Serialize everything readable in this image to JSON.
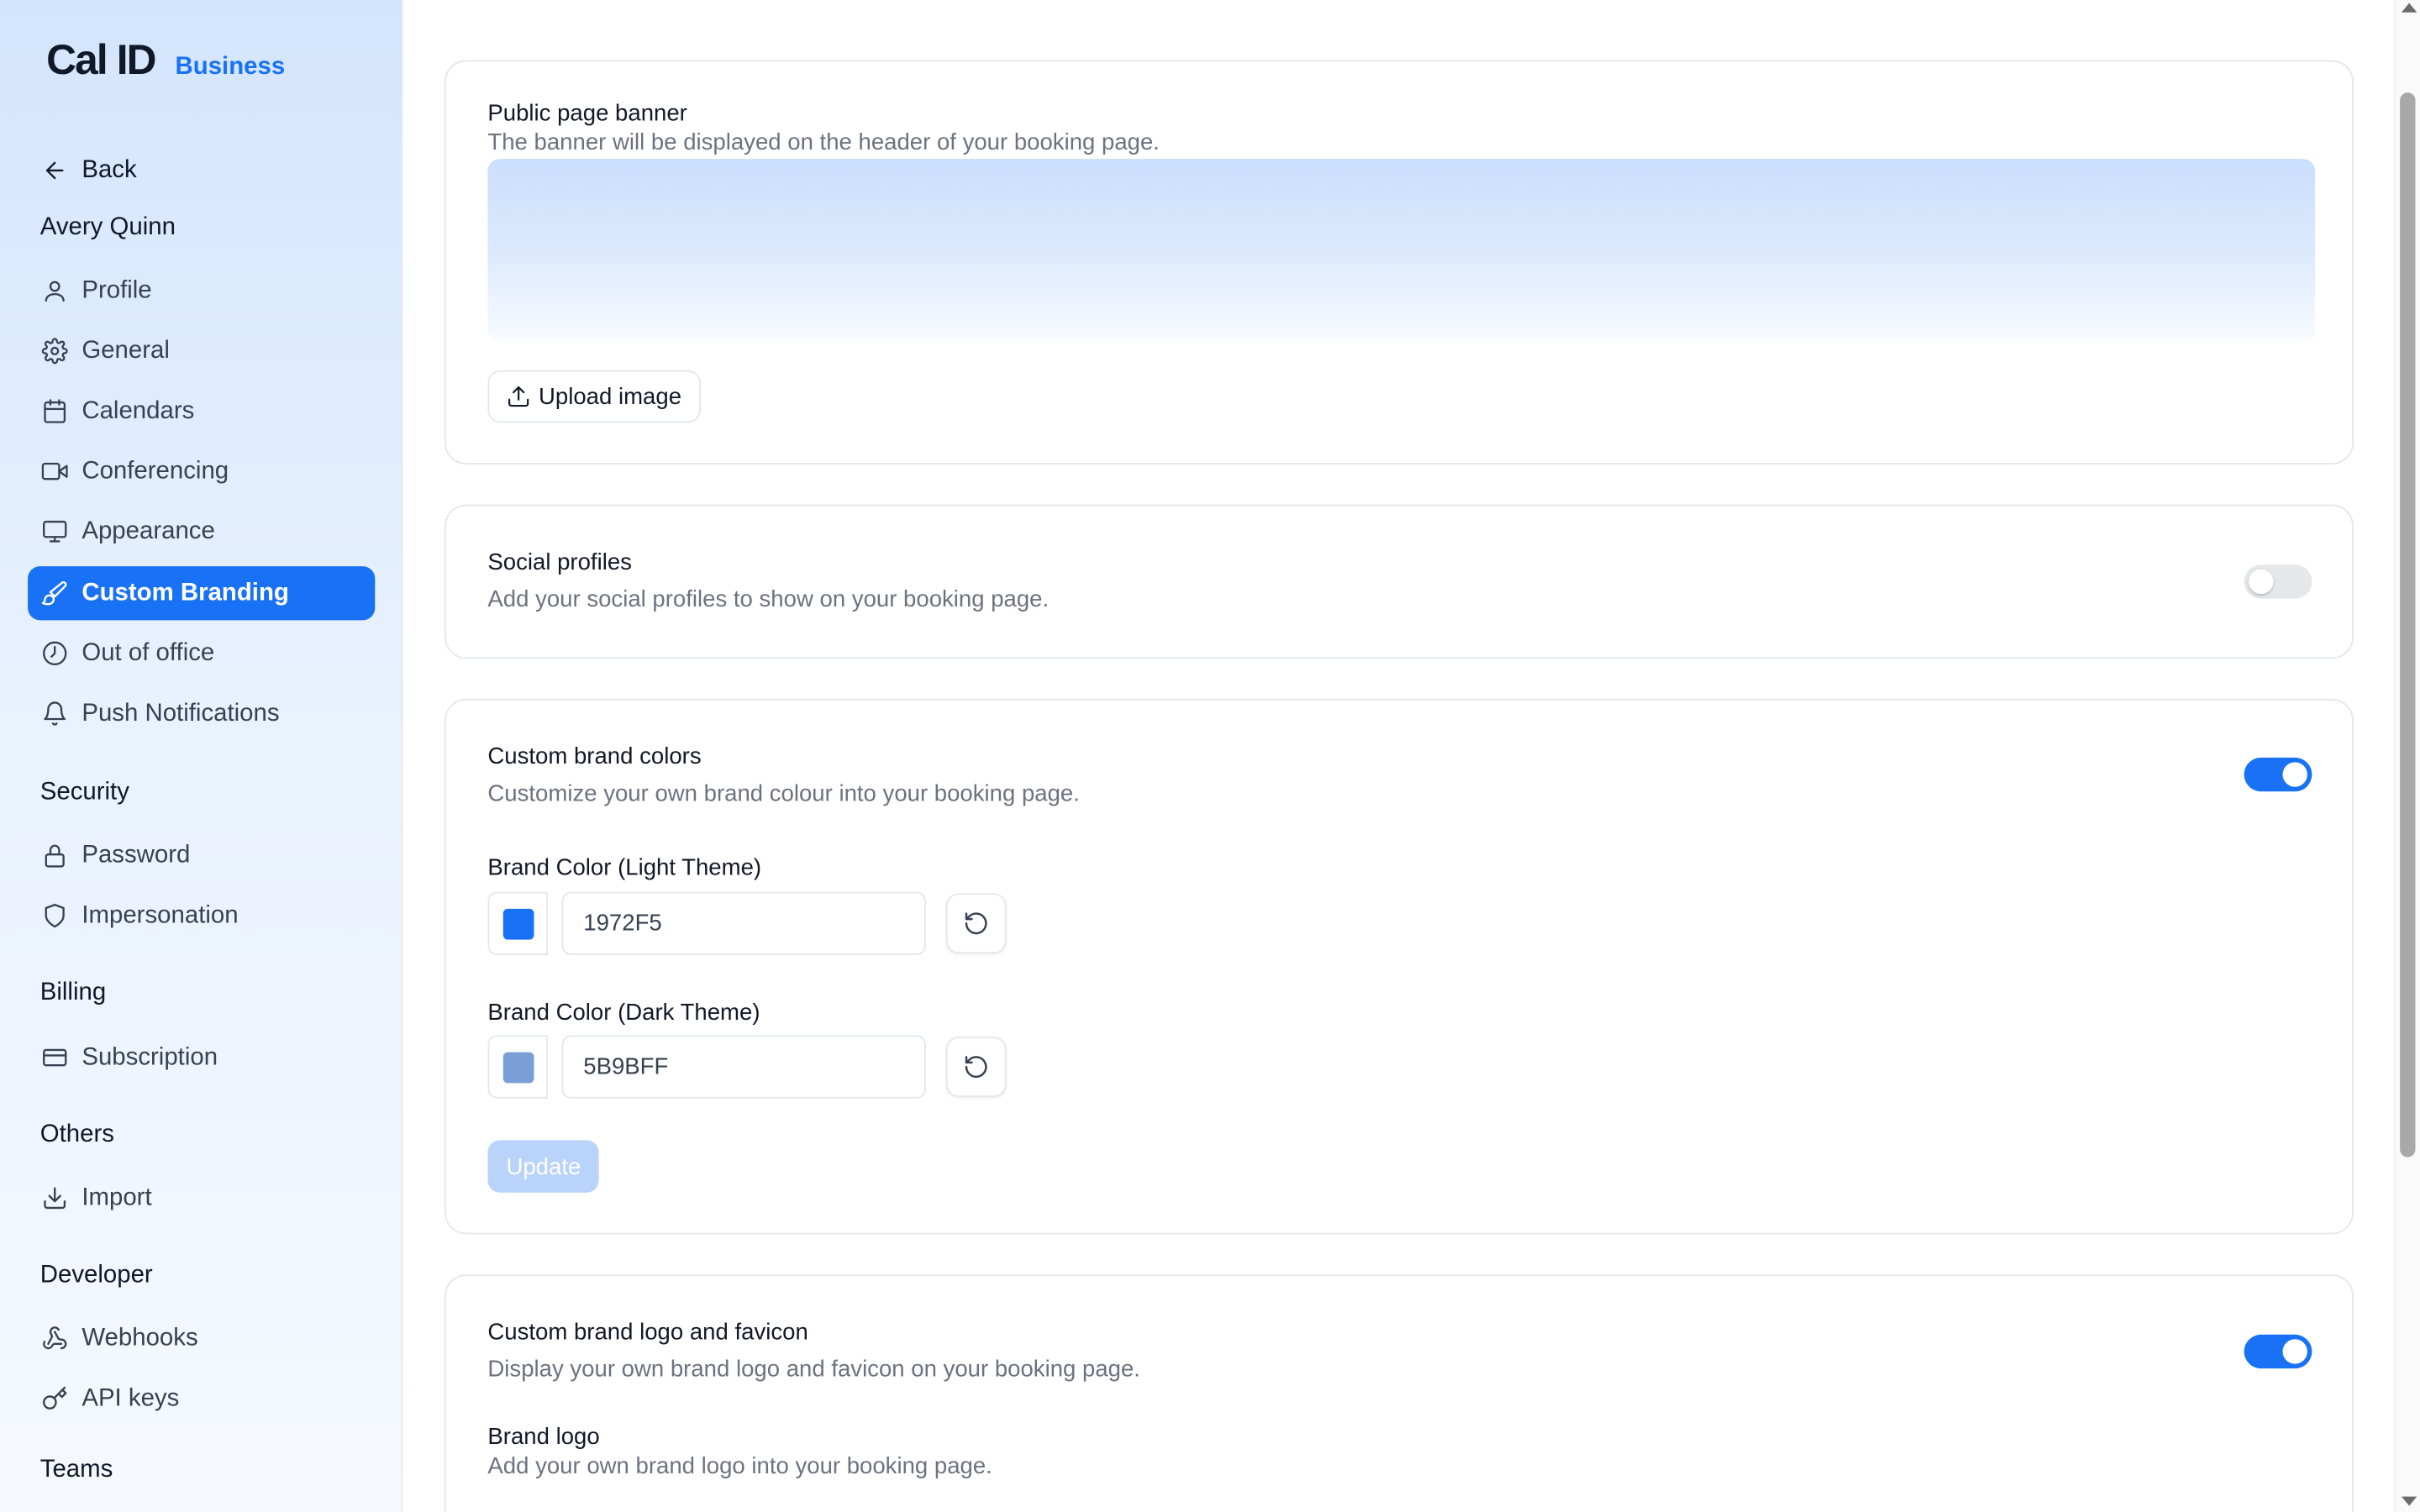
{
  "brand": {
    "logo": "Cal ID",
    "tier": "Business",
    "accent": "#1972F5"
  },
  "sidebar": {
    "back_label": "Back",
    "user_name": "Avery Quinn",
    "items": [
      {
        "label": "Profile",
        "icon": "user-icon"
      },
      {
        "label": "General",
        "icon": "gear-icon"
      },
      {
        "label": "Calendars",
        "icon": "calendar-icon"
      },
      {
        "label": "Conferencing",
        "icon": "video-icon"
      },
      {
        "label": "Appearance",
        "icon": "monitor-icon"
      },
      {
        "label": "Custom Branding",
        "icon": "brush-icon",
        "active": true
      },
      {
        "label": "Out of office",
        "icon": "clock-icon"
      },
      {
        "label": "Push Notifications",
        "icon": "bell-icon"
      }
    ],
    "sections": {
      "security": {
        "title": "Security",
        "items": [
          {
            "label": "Password",
            "icon": "lock-icon"
          },
          {
            "label": "Impersonation",
            "icon": "shield-icon"
          }
        ]
      },
      "billing": {
        "title": "Billing",
        "items": [
          {
            "label": "Subscription",
            "icon": "credit-card-icon"
          }
        ]
      },
      "others": {
        "title": "Others",
        "items": [
          {
            "label": "Import",
            "icon": "download-icon"
          }
        ]
      },
      "developer": {
        "title": "Developer",
        "items": [
          {
            "label": "Webhooks",
            "icon": "webhook-icon"
          },
          {
            "label": "API keys",
            "icon": "key-icon"
          }
        ]
      },
      "teams": {
        "title": "Teams"
      }
    }
  },
  "main": {
    "banner_card": {
      "title": "Public page banner",
      "description": "The banner will be displayed on the header of your booking page.",
      "upload_label": "Upload image"
    },
    "social_card": {
      "title": "Social profiles",
      "description": "Add your social profiles to show on your booking page.",
      "enabled": false
    },
    "colors_card": {
      "title": "Custom brand colors",
      "description": "Customize your own brand colour into your booking page.",
      "enabled": true,
      "light_label": "Brand Color (Light Theme)",
      "light_value": "1972F5",
      "light_swatch": "#1972F5",
      "dark_label": "Brand Color (Dark Theme)",
      "dark_value": "5B9BFF",
      "dark_swatch": "#7a9fd6",
      "update_label": "Update"
    },
    "logo_card": {
      "title": "Custom brand logo and favicon",
      "description": "Display your own brand logo and favicon on your booking page.",
      "enabled": true,
      "brand_logo_label": "Brand logo",
      "brand_logo_desc": "Add your own brand logo into your booking page."
    }
  }
}
